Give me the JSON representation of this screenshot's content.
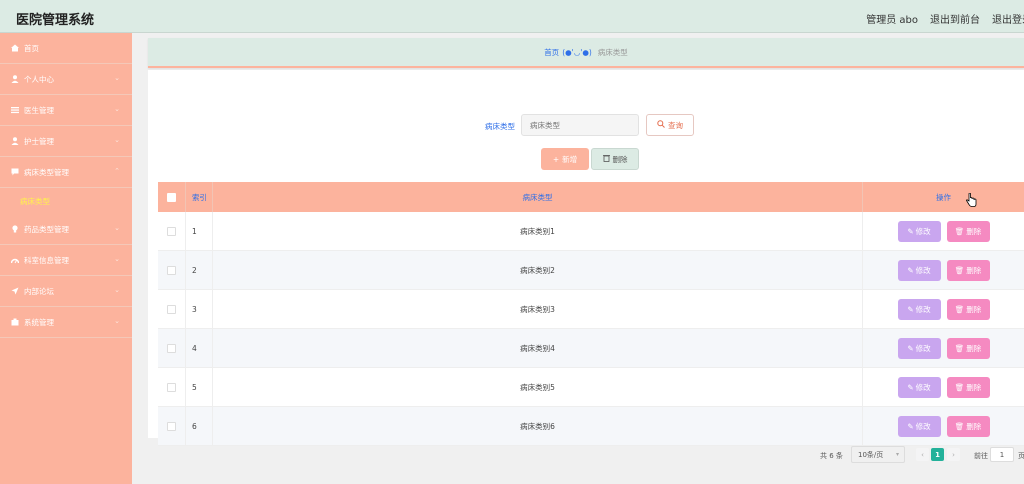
{
  "header": {
    "title": "医院管理系统",
    "admin": "管理员 abo",
    "to_front": "退出到前台",
    "logout": "退出登录"
  },
  "sidebar": {
    "items": [
      {
        "label": "首页",
        "icon": "home-icon"
      },
      {
        "label": "个人中心",
        "icon": "user-icon"
      },
      {
        "label": "医生管理",
        "icon": "list-icon"
      },
      {
        "label": "护士管理",
        "icon": "user-icon"
      },
      {
        "label": "病床类型管理",
        "icon": "message-icon"
      },
      {
        "label": "药品类型管理",
        "icon": "bulb-icon"
      },
      {
        "label": "科室信息管理",
        "icon": "dashboard-icon"
      },
      {
        "label": "内部论坛",
        "icon": "send-icon"
      },
      {
        "label": "系统管理",
        "icon": "box-icon"
      }
    ],
    "sub_item": "病床类型"
  },
  "breadcrumb": {
    "home": "首页",
    "emoji": "(●'◡'●)",
    "current": "病床类型"
  },
  "search": {
    "label": "病床类型",
    "placeholder": "病床类型",
    "button": "查询"
  },
  "actions": {
    "add": "新增",
    "delete": "删除"
  },
  "table": {
    "headers": {
      "index": "索引",
      "type": "病床类型",
      "ops": "操作"
    },
    "rows": [
      {
        "index": "1",
        "type": "病床类别1"
      },
      {
        "index": "2",
        "type": "病床类别2"
      },
      {
        "index": "3",
        "type": "病床类别3"
      },
      {
        "index": "4",
        "type": "病床类别4"
      },
      {
        "index": "5",
        "type": "病床类别5"
      },
      {
        "index": "6",
        "type": "病床类别6"
      }
    ],
    "edit_label": "修改",
    "delete_label": "删除"
  },
  "pagination": {
    "total": "共 6 条",
    "page_size": "10条/页",
    "current_page": "1",
    "goto_label": "前往",
    "goto_value": "1",
    "page_suffix": "页"
  },
  "colors": {
    "sidebar": "#fcb39d",
    "topbar": "#dcebe4",
    "edit_button": "#c9a6ef",
    "delete_button": "#f58ac1",
    "page_active": "#23b19a"
  }
}
